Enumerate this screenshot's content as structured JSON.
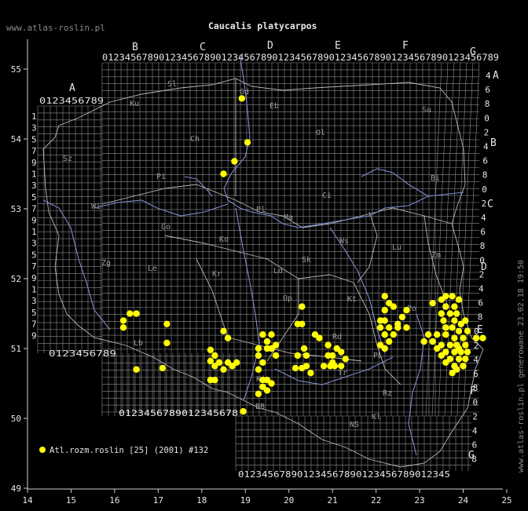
{
  "header": {
    "site": "www.atlas-roslin.pl",
    "title": "Caucalis platycarpos"
  },
  "side_note": "www.atlas-roslin.pl generowane 23.02.18 19:50",
  "legend": {
    "label": "Atl.rozm.roslin [25] (2001) #132",
    "marker_color": "#ffff00"
  },
  "colors": {
    "background": "#000000",
    "grid": "#8c8c8c",
    "rivers": "#7f8ccc",
    "borders": "#b4b4b4",
    "points": "#ffff00"
  },
  "axes": {
    "x_ticks": [
      "14",
      "15",
      "16",
      "17",
      "18",
      "19",
      "20",
      "21",
      "22",
      "23",
      "24",
      "25"
    ],
    "y_ticks": [
      "55",
      "54",
      "53",
      "52",
      "51",
      "50",
      "49"
    ]
  },
  "grid_letters_top": [
    "A",
    "B",
    "C",
    "D",
    "E",
    "F",
    "G"
  ],
  "grid_letters_right": [
    "A",
    "B",
    "C",
    "D",
    "E",
    "F",
    "G"
  ],
  "digit_rows": {
    "top_main": "0123456789012345678901234567890123456789012345678901234567890123456789",
    "top_left": "0123456789",
    "mid_left": "0123456789",
    "bottom_mid": "0123456789012345678",
    "bottom_right": "012345678901234567890123456789012345"
  },
  "digit_columns": {
    "left": [
      "1",
      "3",
      "5",
      "7",
      "9",
      "1",
      "3",
      "5",
      "7",
      "9",
      "1",
      "3",
      "5",
      "7",
      "9",
      "1",
      "3",
      "5",
      "7",
      "9"
    ],
    "right": [
      "4",
      "6",
      "8",
      "0",
      "2",
      "4",
      "6",
      "8",
      "0",
      "2",
      "4",
      "6",
      "8",
      "0",
      "2",
      "4",
      "6",
      "8",
      "0",
      "2",
      "4",
      "6",
      "8",
      "0",
      "2",
      "4",
      "6",
      "8"
    ]
  },
  "regions": [
    "Sl",
    "Ku",
    "Eb",
    "Su",
    "Ol",
    "Ch",
    "Gd",
    "Pi",
    "Ci",
    "Bi",
    "Wi",
    "Ma",
    "Pl",
    "Sz",
    "Go",
    "Ko",
    "Ws",
    "Zg",
    "Le",
    "Kr",
    "Ld",
    "Sk",
    "Lu",
    "Zm",
    "Po",
    "Op",
    "Kt",
    "Ki",
    "Rd",
    "Tr",
    "Rz",
    "PL",
    "Lb",
    "NS",
    "Kl",
    "BB"
  ],
  "chart_data": {
    "type": "scatter",
    "title": "Caucalis platycarpos",
    "xlim": [
      14,
      25
    ],
    "ylim": [
      49,
      55.5
    ],
    "series": [
      {
        "name": "Atl.rozm.roslin [25] (2001) #132",
        "color": "#ffff00",
        "points": [
          [
            18.92,
            54.58
          ],
          [
            19.05,
            53.95
          ],
          [
            18.75,
            53.68
          ],
          [
            18.5,
            53.5
          ],
          [
            17.2,
            51.35
          ],
          [
            17.2,
            51.08
          ],
          [
            16.2,
            51.4
          ],
          [
            16.2,
            51.3
          ],
          [
            16.35,
            51.5
          ],
          [
            16.5,
            51.5
          ],
          [
            16.5,
            50.7
          ],
          [
            17.1,
            50.72
          ],
          [
            18.5,
            51.25
          ],
          [
            18.6,
            51.15
          ],
          [
            18.2,
            50.98
          ],
          [
            18.3,
            50.9
          ],
          [
            18.2,
            50.82
          ],
          [
            18.3,
            50.75
          ],
          [
            18.4,
            50.8
          ],
          [
            18.6,
            50.8
          ],
          [
            18.7,
            50.75
          ],
          [
            18.8,
            50.8
          ],
          [
            18.5,
            50.7
          ],
          [
            18.2,
            50.55
          ],
          [
            18.3,
            50.55
          ],
          [
            18.95,
            50.1
          ],
          [
            19.4,
            51.2
          ],
          [
            19.6,
            51.2
          ],
          [
            19.5,
            51.1
          ],
          [
            19.7,
            51.05
          ],
          [
            19.3,
            51.0
          ],
          [
            19.5,
            51.0
          ],
          [
            19.6,
            51.0
          ],
          [
            19.7,
            50.9
          ],
          [
            19.3,
            50.9
          ],
          [
            19.4,
            50.8
          ],
          [
            19.3,
            50.7
          ],
          [
            19.4,
            50.55
          ],
          [
            19.5,
            50.55
          ],
          [
            19.6,
            50.5
          ],
          [
            19.4,
            50.45
          ],
          [
            19.5,
            50.4
          ],
          [
            19.3,
            50.35
          ],
          [
            20.3,
            51.6
          ],
          [
            20.2,
            51.35
          ],
          [
            20.3,
            51.35
          ],
          [
            20.6,
            51.2
          ],
          [
            20.7,
            51.15
          ],
          [
            20.35,
            51.0
          ],
          [
            20.2,
            50.9
          ],
          [
            20.4,
            50.9
          ],
          [
            20.15,
            50.72
          ],
          [
            20.3,
            50.72
          ],
          [
            20.4,
            50.75
          ],
          [
            20.5,
            50.65
          ],
          [
            20.9,
            51.05
          ],
          [
            21.1,
            51.0
          ],
          [
            20.9,
            50.9
          ],
          [
            21.0,
            50.9
          ],
          [
            21.2,
            50.95
          ],
          [
            21.0,
            50.8
          ],
          [
            20.8,
            50.75
          ],
          [
            20.95,
            50.75
          ],
          [
            21.05,
            50.75
          ],
          [
            21.3,
            50.85
          ],
          [
            21.2,
            50.75
          ],
          [
            22.2,
            51.75
          ],
          [
            22.3,
            51.65
          ],
          [
            22.2,
            51.55
          ],
          [
            22.4,
            51.6
          ],
          [
            22.1,
            51.4
          ],
          [
            22.2,
            51.4
          ],
          [
            22.3,
            51.3
          ],
          [
            22.1,
            51.3
          ],
          [
            22.2,
            51.2
          ],
          [
            22.4,
            51.2
          ],
          [
            22.3,
            51.1
          ],
          [
            22.1,
            51.05
          ],
          [
            22.2,
            51.0
          ],
          [
            22.5,
            51.3
          ],
          [
            22.7,
            51.3
          ],
          [
            22.6,
            51.45
          ],
          [
            22.7,
            51.55
          ],
          [
            22.5,
            51.35
          ],
          [
            23.3,
            51.65
          ],
          [
            23.5,
            51.7
          ],
          [
            23.6,
            51.75
          ],
          [
            23.75,
            51.75
          ],
          [
            23.6,
            51.6
          ],
          [
            23.8,
            51.6
          ],
          [
            23.9,
            51.7
          ],
          [
            23.5,
            51.5
          ],
          [
            23.7,
            51.5
          ],
          [
            23.85,
            51.5
          ],
          [
            23.55,
            51.4
          ],
          [
            23.8,
            51.4
          ],
          [
            23.95,
            51.35
          ],
          [
            24.05,
            51.4
          ],
          [
            23.6,
            51.3
          ],
          [
            23.75,
            51.3
          ],
          [
            23.9,
            51.25
          ],
          [
            24.1,
            51.25
          ],
          [
            23.4,
            51.2
          ],
          [
            23.6,
            51.2
          ],
          [
            23.8,
            51.15
          ],
          [
            24.0,
            51.15
          ],
          [
            23.3,
            51.1
          ],
          [
            23.5,
            51.05
          ],
          [
            23.7,
            51.05
          ],
          [
            23.85,
            51.05
          ],
          [
            24.05,
            51.05
          ],
          [
            23.4,
            51.0
          ],
          [
            23.6,
            50.95
          ],
          [
            23.8,
            50.95
          ],
          [
            23.95,
            50.95
          ],
          [
            23.5,
            50.9
          ],
          [
            23.7,
            50.85
          ],
          [
            23.9,
            50.85
          ],
          [
            24.05,
            50.85
          ],
          [
            23.6,
            50.8
          ],
          [
            23.8,
            50.75
          ],
          [
            24.0,
            50.75
          ],
          [
            23.85,
            50.7
          ],
          [
            23.75,
            50.65
          ],
          [
            23.1,
            51.1
          ],
          [
            23.2,
            51.2
          ],
          [
            24.3,
            51.15
          ],
          [
            24.45,
            51.15
          ],
          [
            24.1,
            50.95
          ],
          [
            23.9,
            51.0
          ]
        ]
      }
    ]
  }
}
